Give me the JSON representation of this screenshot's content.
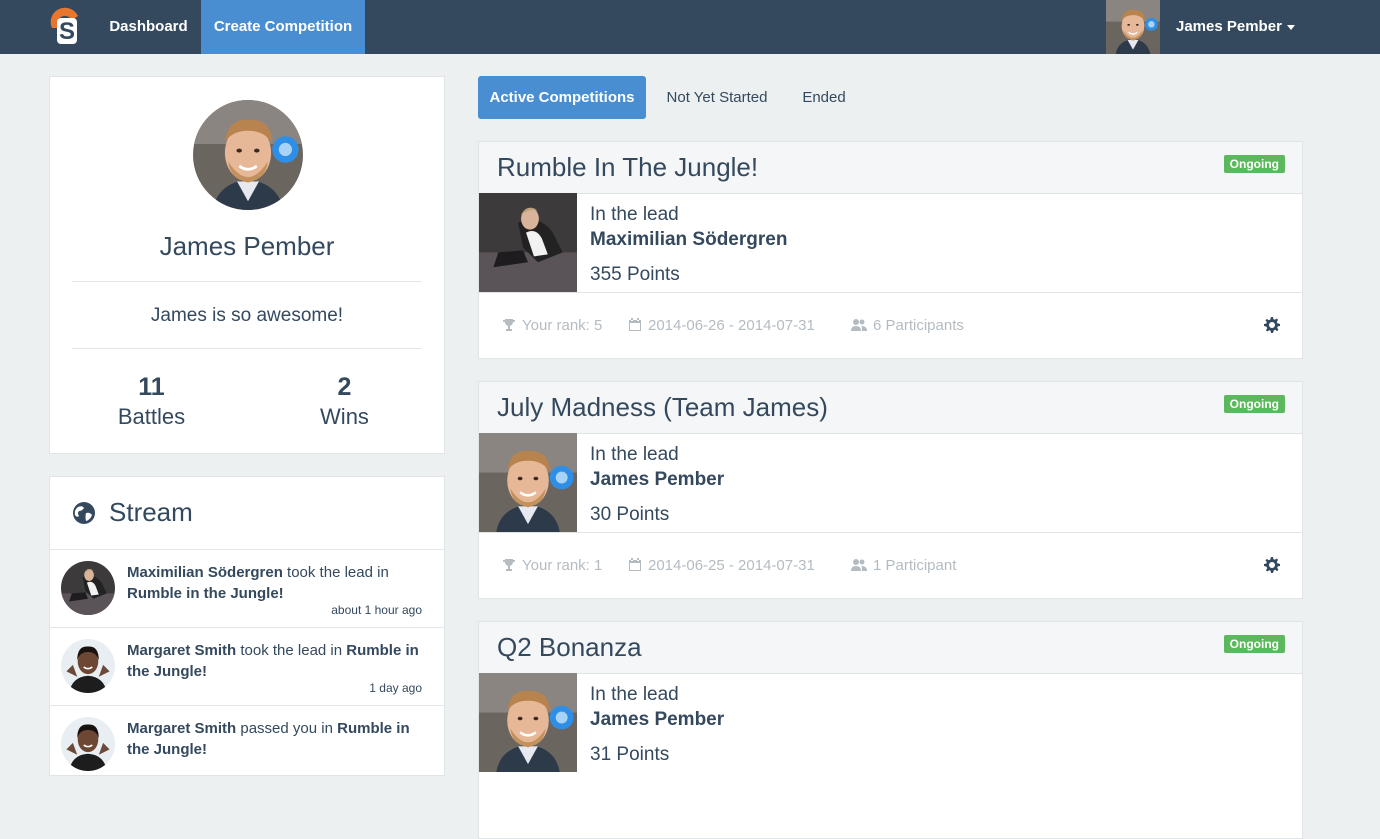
{
  "navbar": {
    "logo_letter": "S",
    "items": [
      {
        "label": "Dashboard"
      },
      {
        "label": "Create Competition"
      }
    ],
    "user_name": "James Pember"
  },
  "profile": {
    "name": "James Pember",
    "bio": "James is so awesome!",
    "stats": [
      {
        "value": "11",
        "label": "Battles"
      },
      {
        "value": "2",
        "label": "Wins"
      }
    ]
  },
  "stream": {
    "title": "Stream",
    "items": [
      {
        "actor": "Maximilian Södergren",
        "action": " took the lead in ",
        "target": "Rumble in the Jungle!",
        "time": "about 1 hour ago"
      },
      {
        "actor": "Margaret Smith",
        "action": " took the lead in ",
        "target": "Rumble in the Jungle!",
        "time": "1 day ago"
      },
      {
        "actor": "Margaret Smith",
        "action": " passed you in ",
        "target": "Rumble in the Jungle!",
        "time": ""
      }
    ]
  },
  "tabs": [
    {
      "label": "Active Competitions"
    },
    {
      "label": "Not Yet Started"
    },
    {
      "label": "Ended"
    }
  ],
  "competitions": [
    {
      "title": "Rumble In The Jungle!",
      "status": "Ongoing",
      "lead_label": "In the lead",
      "leader": "Maximilian Södergren",
      "points": "355 Points",
      "rank": "Your rank: 5",
      "dates": "2014-06-26 - 2014-07-31",
      "participants": "6 Participants"
    },
    {
      "title": "July Madness (Team James)",
      "status": "Ongoing",
      "lead_label": "In the lead",
      "leader": "James Pember",
      "points": "30 Points",
      "rank": "Your rank: 1",
      "dates": "2014-06-25 - 2014-07-31",
      "participants": "1 Participant"
    },
    {
      "title": "Q2 Bonanza",
      "status": "Ongoing",
      "lead_label": "In the lead",
      "leader": "James Pember",
      "points": "31 Points",
      "rank": "",
      "dates": "",
      "participants": ""
    }
  ],
  "colors": {
    "navbar": "#34495e",
    "accent": "#4a8ed2",
    "ongoing": "#5cb85c",
    "page_bg": "#ecf0f1"
  }
}
